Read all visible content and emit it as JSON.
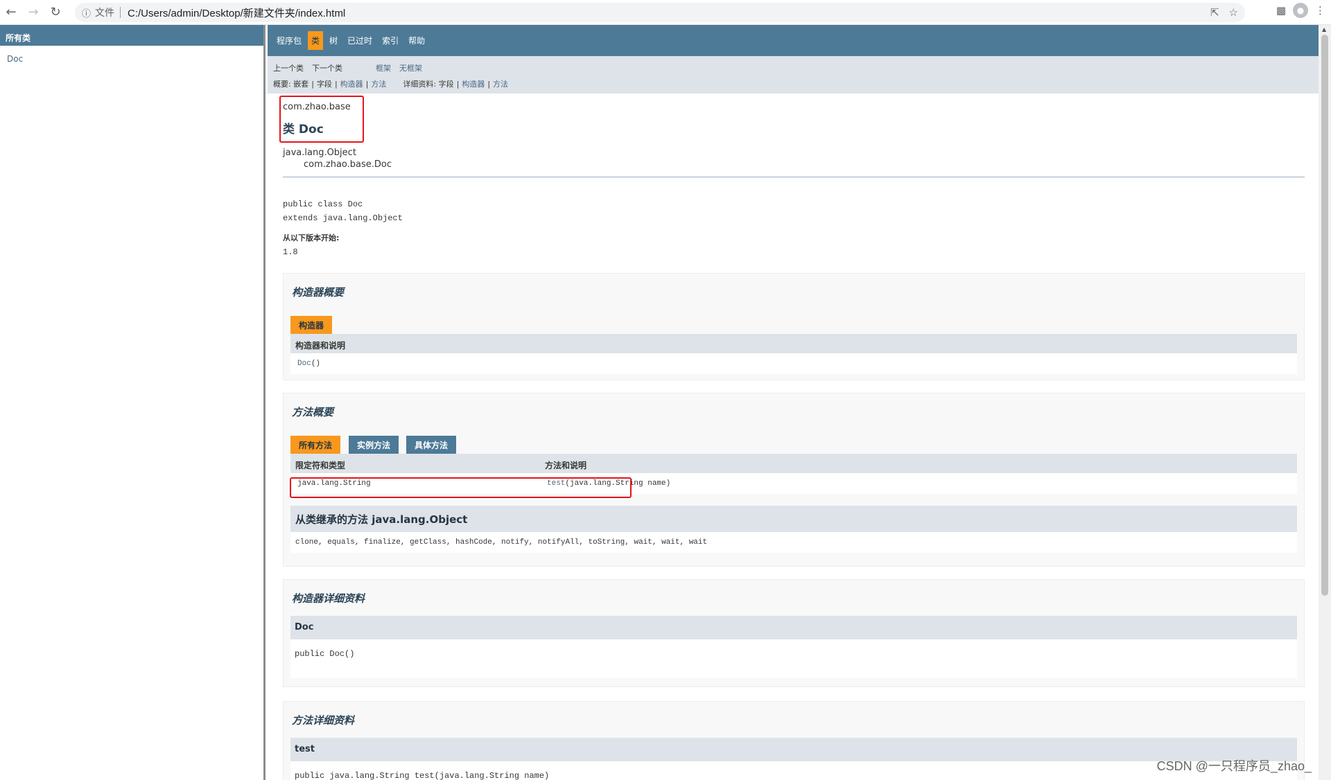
{
  "browser": {
    "scheme_label": "文件",
    "url": "C:/Users/admin/Desktop/新建文件夹/index.html"
  },
  "left_frame": {
    "header": "所有类",
    "classes": [
      "Doc"
    ]
  },
  "top_nav": {
    "items": [
      "程序包",
      "类",
      "树",
      "已过时",
      "索引",
      "帮助"
    ],
    "active_index": 1
  },
  "sub_nav": {
    "prev_class": "上一个类",
    "next_class": "下一个类",
    "frames": "框架",
    "no_frames": "无框架",
    "summary_label": "概要:",
    "summary_nested": "嵌套",
    "summary_field": "字段",
    "summary_constructor": "构造器",
    "summary_method": "方法",
    "detail_label": "详细资料:",
    "detail_field": "字段",
    "detail_constructor": "构造器",
    "detail_method": "方法",
    "pipe": "|"
  },
  "class_info": {
    "package": "com.zhao.base",
    "title": "类 Doc",
    "inheritance_parent": "java.lang.Object",
    "inheritance_child": "com.zhao.base.Doc",
    "signature_line1": "public class Doc",
    "signature_line2": "extends java.lang.Object",
    "since_label": "从以下版本开始:",
    "since_value": "1.8"
  },
  "constructor_summary": {
    "title": "构造器概要",
    "tab": "构造器",
    "header": "构造器和说明",
    "rows": [
      {
        "name": "Doc",
        "params": "()"
      }
    ]
  },
  "method_summary": {
    "title": "方法概要",
    "tabs": [
      "所有方法",
      "实例方法",
      "具体方法"
    ],
    "header_modifier": "限定符和类型",
    "header_method": "方法和说明",
    "rows": [
      {
        "type": "java.lang.String",
        "name": "test",
        "params": "(java.lang.String  name)"
      }
    ],
    "inherited_title": "从类继承的方法 java.lang.Object",
    "inherited_methods": "clone, equals, finalize, getClass, hashCode, notify, notifyAll, toString, wait, wait, wait"
  },
  "constructor_detail": {
    "title": "构造器详细资料",
    "name": "Doc",
    "signature": "public  Doc()"
  },
  "method_detail": {
    "title": "方法详细资料",
    "name": "test",
    "signature": "public  java.lang.String  test(java.lang.String  name)"
  },
  "watermark": "CSDN @一只程序员_zhao_",
  "colors": {
    "nav_bg": "#4d7a97",
    "active_tab": "#f8981d",
    "subnav_bg": "#dee3e9",
    "highlight_border": "#e3141a"
  }
}
